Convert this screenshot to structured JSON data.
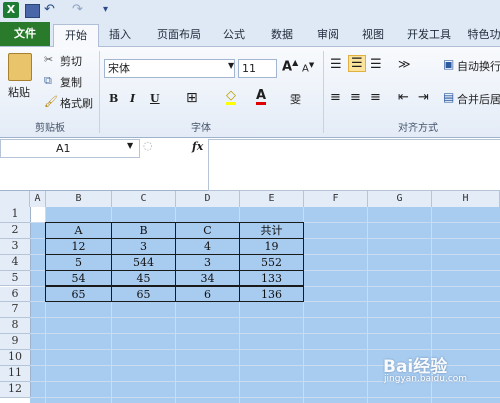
{
  "app": {
    "quick_access": [
      "excel-logo-icon",
      "save-icon",
      "undo-icon",
      "redo-icon",
      "customize-icon"
    ]
  },
  "tabs": [
    "文件",
    "开始",
    "插入",
    "页面布局",
    "公式",
    "数据",
    "审阅",
    "视图",
    "开发工具",
    "特色功"
  ],
  "ribbon": {
    "clipboard": {
      "paste": "粘贴",
      "cut": "剪切",
      "copy": "复制",
      "format_painter": "格式刷",
      "label": "剪贴板"
    },
    "font": {
      "name": "宋体",
      "size": "11",
      "bold": "B",
      "italic": "I",
      "underline": "U",
      "label": "字体",
      "wen": "雯"
    },
    "align": {
      "wrap": "自动换行",
      "merge": "合并后居",
      "label": "对齐方式"
    }
  },
  "formula_bar": {
    "name_box": "A1",
    "fx": "fx",
    "value": ""
  },
  "sheet": {
    "columns": [
      "A",
      "B",
      "C",
      "D",
      "E",
      "F",
      "G",
      "H"
    ],
    "rows": [
      "1",
      "2",
      "3",
      "4",
      "5",
      "6",
      "7",
      "8",
      "9",
      "10",
      "11",
      "12"
    ],
    "table": [
      [
        "A",
        "B",
        "C",
        "共计"
      ],
      [
        "12",
        "3",
        "4",
        "19"
      ],
      [
        "5",
        "544",
        "3",
        "552"
      ],
      [
        "54",
        "45",
        "34",
        "133"
      ],
      [
        "65",
        "65",
        "6",
        "136"
      ]
    ],
    "selection_color": "#a8cbf0"
  },
  "watermark": {
    "text": "Bai经验",
    "url": "jingyan.baidu.com"
  }
}
